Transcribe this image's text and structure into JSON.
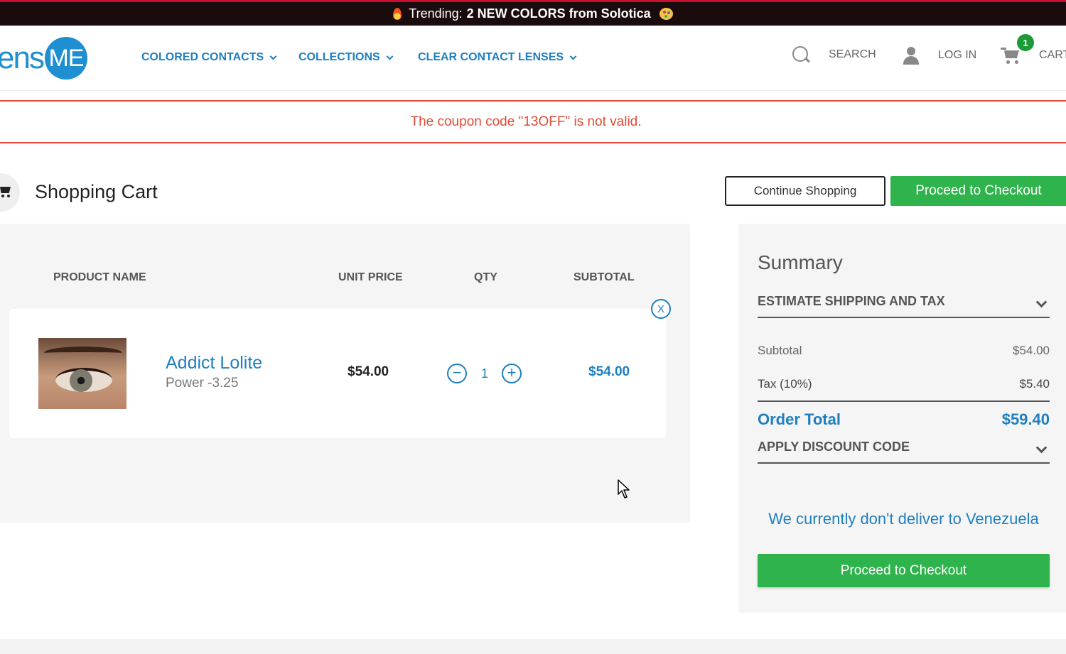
{
  "banner": {
    "prefix": "Trending:",
    "highlight": "2 NEW COLORS from Solotica"
  },
  "header": {
    "logo_text": "ens",
    "logo_badge": "ME",
    "nav": [
      "COLORED CONTACTS",
      "COLLECTIONS",
      "CLEAR CONTACT LENSES"
    ],
    "search_label": "SEARCH",
    "login_label": "LOG IN",
    "cart_label": "CART",
    "cart_count": "1"
  },
  "alert": {
    "message": "The coupon code \"13OFF\" is not valid."
  },
  "page": {
    "title": "Shopping Cart",
    "continue_label": "Continue Shopping",
    "checkout_label": "Proceed to Checkout"
  },
  "cart": {
    "columns": [
      "PRODUCT NAME",
      "UNIT PRICE",
      "QTY",
      "SUBTOTAL"
    ],
    "remove_label": "X",
    "items": [
      {
        "name": "Addict Lolite",
        "option": "Power -3.25",
        "unit_price": "$54.00",
        "qty": "1",
        "subtotal": "$54.00"
      }
    ]
  },
  "summary": {
    "title": "Summary",
    "shipping_toggle": "ESTIMATE SHIPPING AND TAX",
    "subtotal_label": "Subtotal",
    "subtotal_value": "$54.00",
    "tax_label": "Tax (10%)",
    "tax_value": "$5.40",
    "total_label": "Order Total",
    "total_value": "$59.40",
    "discount_toggle": "APPLY DISCOUNT CODE",
    "delivery_message": "We currently don't deliver to Venezuela",
    "checkout_label": "Proceed to Checkout"
  },
  "colors": {
    "brand_blue": "#1e7fc0",
    "checkout_green": "#2fb34c",
    "error_red": "#e04a35"
  }
}
